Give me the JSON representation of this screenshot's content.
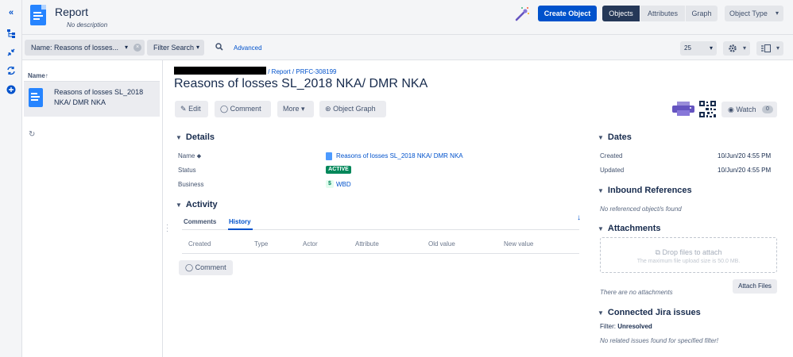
{
  "rail": {
    "icons": [
      "collapse-icon",
      "hierarchy-icon",
      "compress-icon",
      "sync-icon",
      "add-icon"
    ]
  },
  "header": {
    "title": "Report",
    "subtitle": "No description",
    "create_label": "Create Object",
    "views": [
      "Objects",
      "Attributes",
      "Graph"
    ],
    "active_view": "Objects",
    "object_type_label": "Object Type"
  },
  "filterbar": {
    "name_filter": "Name: Reasons of losses...",
    "filter_search": "Filter Search",
    "advanced": "Advanced",
    "page_size": "25"
  },
  "list": {
    "header": "Name",
    "sort_arrow": "↑",
    "items": [
      {
        "label": "Reasons of losses SL_2018 NKA/ DMR NKA"
      }
    ]
  },
  "object": {
    "breadcrumb": "/ Report / PRFC-308199",
    "title": "Reasons of losses SL_2018 NKA/ DMR NKA",
    "actions": {
      "edit": "Edit",
      "comment": "Comment",
      "more": "More",
      "graph": "Object Graph"
    },
    "watch_label": "Watch",
    "watch_count": "0"
  },
  "details": {
    "title": "Details",
    "rows": [
      {
        "label": "Name",
        "value": "Reasons of losses SL_2018 NKA/ DMR NKA"
      },
      {
        "label": "Status",
        "value": "ACTIVE"
      },
      {
        "label": "Business",
        "value": "WBD"
      }
    ]
  },
  "activity": {
    "title": "Activity",
    "tabs": [
      "Comments",
      "History"
    ],
    "active_tab": "History",
    "columns": [
      "Created",
      "Type",
      "Actor",
      "Attribute",
      "Old value",
      "New value"
    ],
    "comment_button": "Comment"
  },
  "dates": {
    "title": "Dates",
    "rows": [
      {
        "label": "Created",
        "value": "10/Jun/20 4:55 PM"
      },
      {
        "label": "Updated",
        "value": "10/Jun/20 4:55 PM"
      }
    ]
  },
  "inbound": {
    "title": "Inbound References",
    "empty": "No referenced object/s found"
  },
  "attachments": {
    "title": "Attachments",
    "drop": "Drop files to attach",
    "max": "The maximum file upload size is 50.0 MB.",
    "empty": "There are no attachments",
    "button": "Attach Files"
  },
  "jira": {
    "title": "Connected Jira issues",
    "filter_label": "Filter:",
    "filter_value": "Unresolved",
    "empty": "No related issues found for specified filter!"
  },
  "colors": {
    "primary": "#0052cc",
    "active_badge": "#00875a",
    "nav_active": "#253858"
  }
}
